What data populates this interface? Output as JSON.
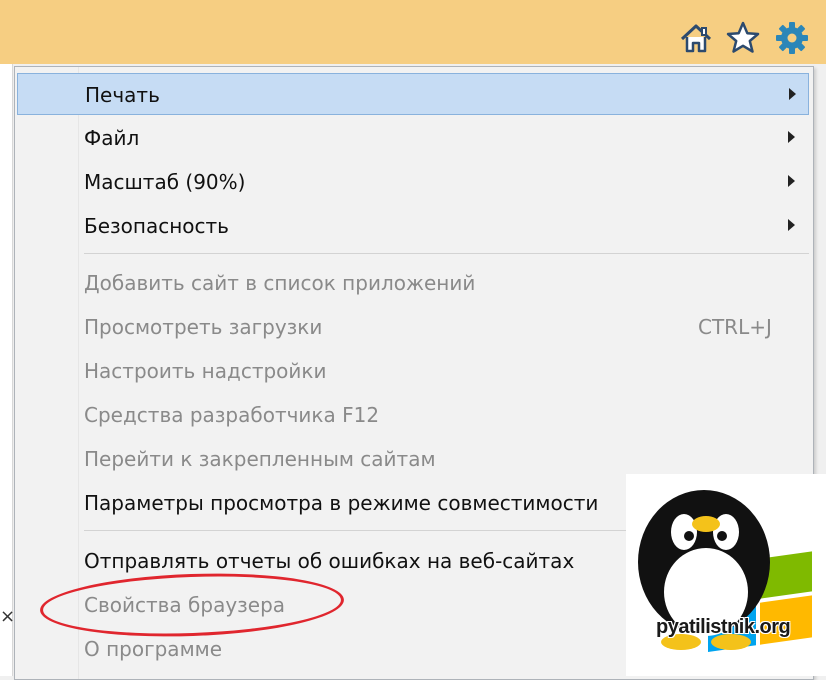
{
  "toolbar": {
    "icons": [
      "home-icon",
      "star-icon",
      "gear-icon"
    ],
    "background": "#f6ce82",
    "gear_color": "#2b86b8"
  },
  "menu": {
    "items": [
      {
        "label": "Печать",
        "submenu": true
      },
      {
        "label": "Файл",
        "submenu": true
      },
      {
        "label": "Масштаб (90%)",
        "submenu": true
      },
      {
        "label": "Безопасность",
        "submenu": true
      },
      {
        "label": "Добавить сайт в список приложений"
      },
      {
        "label": "Просмотреть загрузки",
        "shortcut": "CTRL+J"
      },
      {
        "label": "Настроить надстройки"
      },
      {
        "label": "Средства разработчика F12"
      },
      {
        "label": "Перейти к закрепленным сайтам"
      },
      {
        "label": "Параметры просмотра в режиме совместимости"
      },
      {
        "label": "Отправлять отчеты об ошибках на веб-сайтах"
      },
      {
        "label": "Свойства браузера"
      },
      {
        "label": "О программе"
      }
    ],
    "highlight_color": "#c6dcf4",
    "disabled_color": "#8a8a8a"
  },
  "annotation": {
    "circle_color": "#e0262e"
  },
  "watermark": {
    "text": "pyatilistnik.org"
  },
  "left_edge": {
    "glyph": "×"
  }
}
